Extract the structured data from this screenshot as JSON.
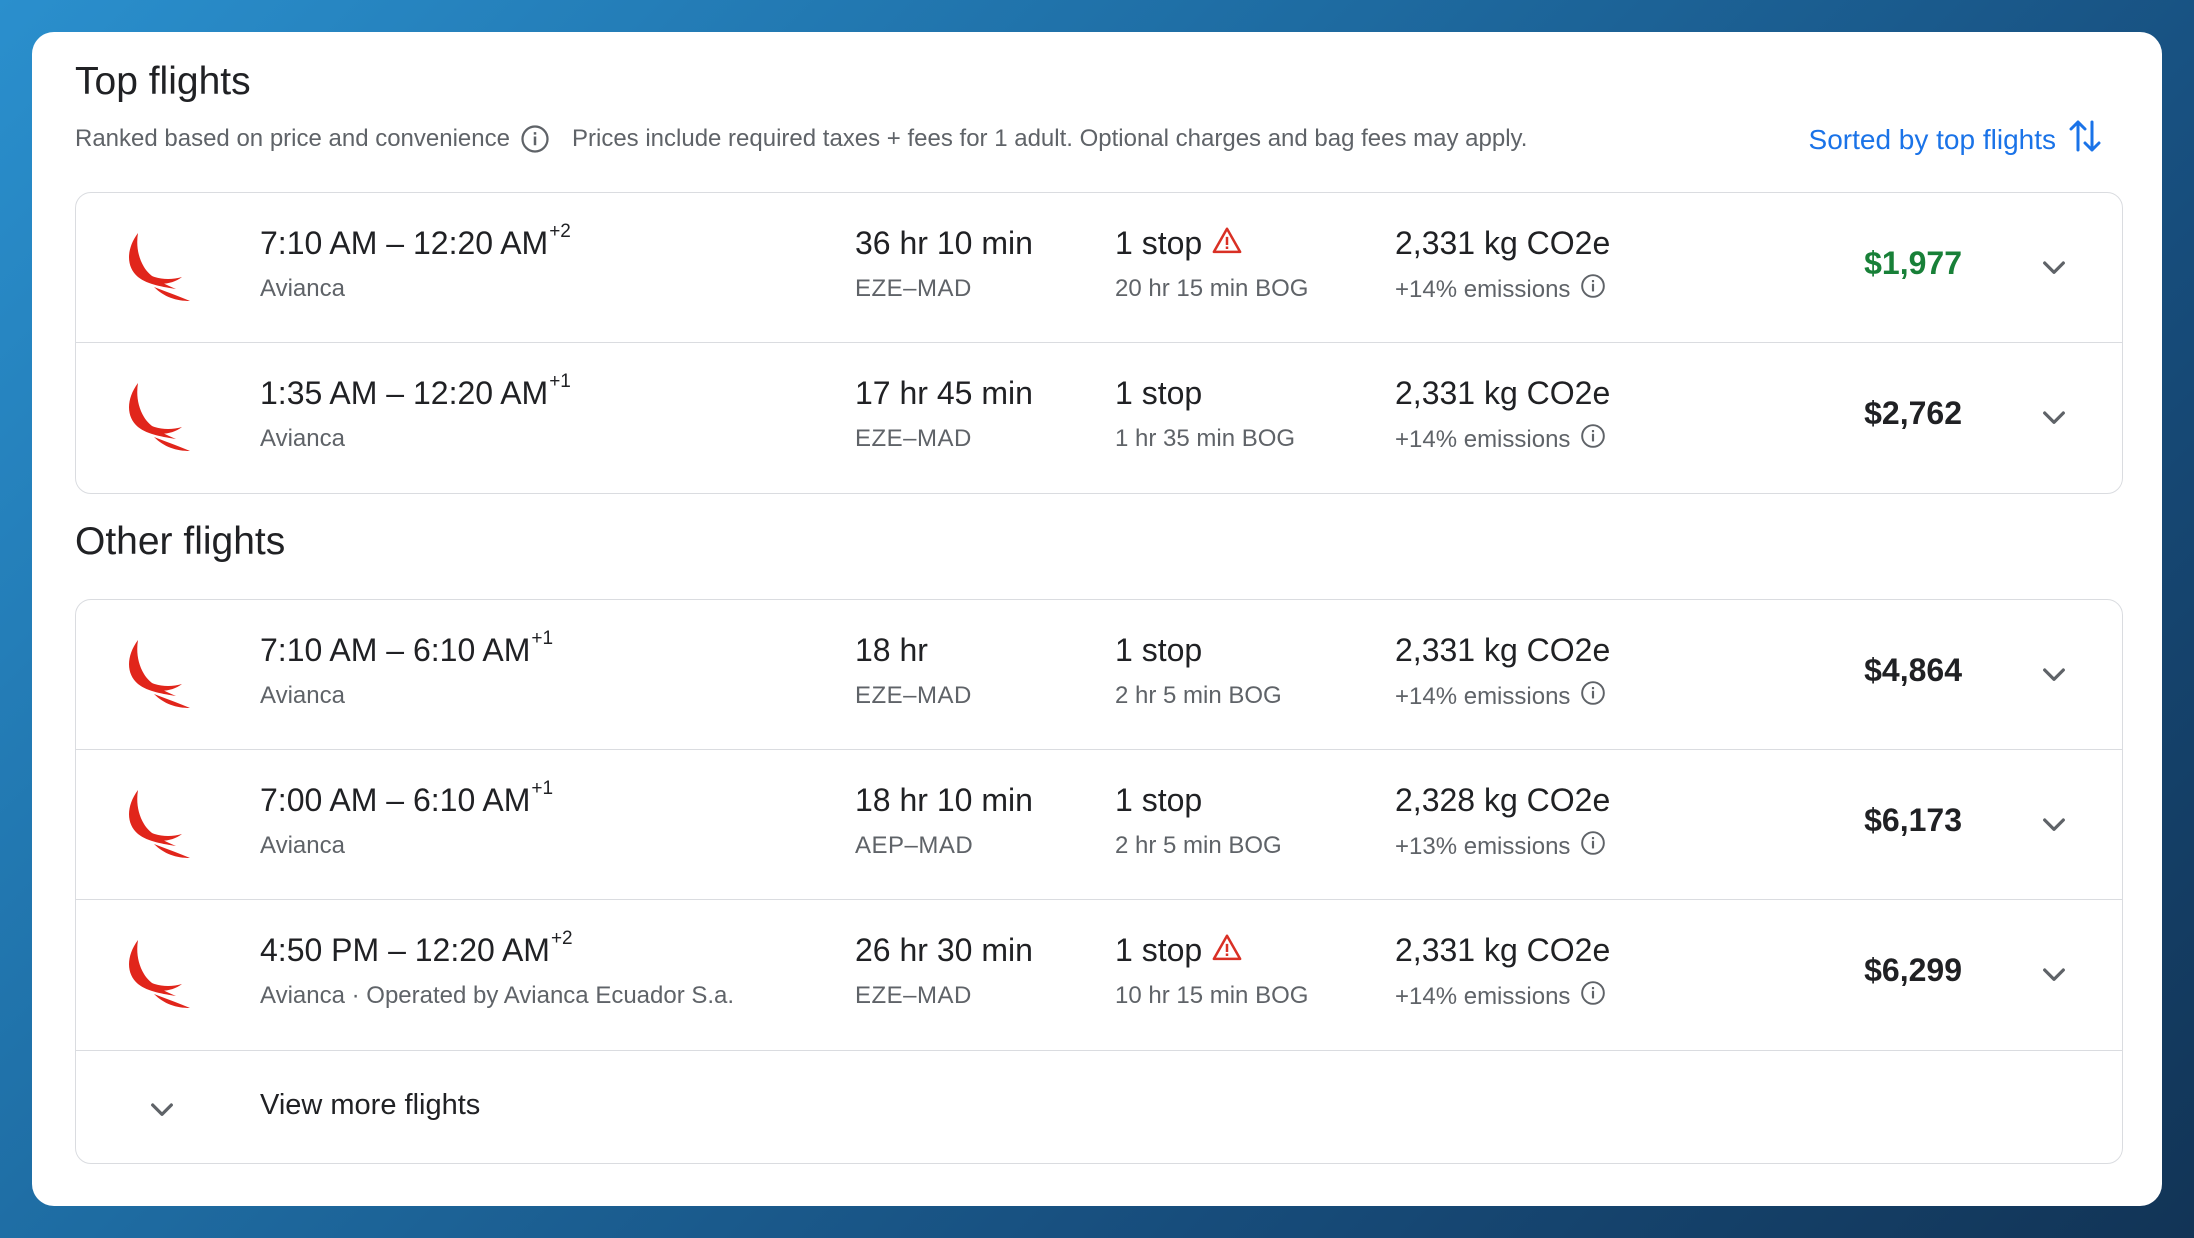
{
  "header": {
    "top_title": "Top flights",
    "ranked_text": "Ranked based on price and convenience",
    "prices_note": "Prices include required taxes + fees for 1 adult. Optional charges and bag fees may apply.",
    "sort_label": "Sorted by top flights"
  },
  "other_title": "Other flights",
  "top_flights": [
    {
      "times": "7:10 AM – 12:20 AM",
      "day_offset": "+2",
      "airline": "Avianca",
      "duration": "36 hr 10 min",
      "route": "EZE–MAD",
      "stops": "1 stop",
      "warning": true,
      "layover": "20 hr 15 min BOG",
      "co2": "2,331 kg CO2e",
      "emissions": "+14% emissions",
      "price": "$1,977",
      "price_highlight": true
    },
    {
      "times": "1:35 AM – 12:20 AM",
      "day_offset": "+1",
      "airline": "Avianca",
      "duration": "17 hr 45 min",
      "route": "EZE–MAD",
      "stops": "1 stop",
      "warning": false,
      "layover": "1 hr 35 min BOG",
      "co2": "2,331 kg CO2e",
      "emissions": "+14% emissions",
      "price": "$2,762",
      "price_highlight": false
    }
  ],
  "other_flights": [
    {
      "times": "7:10 AM – 6:10 AM",
      "day_offset": "+1",
      "airline": "Avianca",
      "duration": "18 hr",
      "route": "EZE–MAD",
      "stops": "1 stop",
      "warning": false,
      "layover": "2 hr 5 min BOG",
      "co2": "2,331 kg CO2e",
      "emissions": "+14% emissions",
      "price": "$4,864",
      "price_highlight": false
    },
    {
      "times": "7:00 AM – 6:10 AM",
      "day_offset": "+1",
      "airline": "Avianca",
      "duration": "18 hr 10 min",
      "route": "AEP–MAD",
      "stops": "1 stop",
      "warning": false,
      "layover": "2 hr 5 min BOG",
      "co2": "2,328 kg CO2e",
      "emissions": "+13% emissions",
      "price": "$6,173",
      "price_highlight": false
    },
    {
      "times": "4:50 PM – 12:20 AM",
      "day_offset": "+2",
      "airline": "Avianca · Operated by Avianca Ecuador S.a.",
      "duration": "26 hr 30 min",
      "route": "EZE–MAD",
      "stops": "1 stop",
      "warning": true,
      "layover": "10 hr 15 min BOG",
      "co2": "2,331 kg CO2e",
      "emissions": "+14% emissions",
      "price": "$6,299",
      "price_highlight": false
    }
  ],
  "view_more_label": "View more flights",
  "colors": {
    "accent": "#1a73e8",
    "price_green": "#188038",
    "warning_red": "#d93025",
    "logo_red": "#e1251b"
  }
}
